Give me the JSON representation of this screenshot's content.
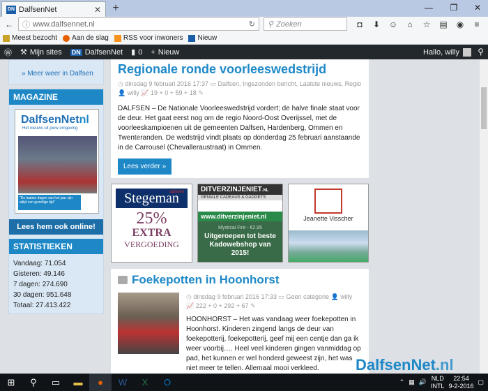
{
  "browser": {
    "tab_title": "DalfsenNet",
    "tab_favicon": "DN",
    "url": "www.dalfsennet.nl",
    "search_placeholder": "Zoeken",
    "bookmarks": [
      {
        "label": "Meest bezocht",
        "icon": "star-icon"
      },
      {
        "label": "Aan de slag",
        "icon": "firefox-icon"
      },
      {
        "label": "RSS voor inwoners",
        "icon": "rss-icon"
      },
      {
        "label": "Nieuw",
        "icon": "dn-icon"
      }
    ]
  },
  "wp_admin": {
    "mijn_sites": "Mijn sites",
    "site_name": "DalfsenNet",
    "comments": "0",
    "new": "Nieuw",
    "greeting": "Hallo, willy"
  },
  "sidebar": {
    "meer_weer": "Meer weer in Dalfsen",
    "magazine_header": "MAGAZINE",
    "magazine_title": "DalfsenNet",
    "magazine_title_suffix": "nl",
    "magazine_sub": "Het nieuws uit jouw omgeving",
    "magazine_caption": "\"De laatste dagen van het jaar zijn altijd een gezellige tijd\"",
    "lees_ook": "Lees hem ook online!",
    "stats_header": "STATISTIEKEN",
    "stats": [
      "Vandaag: 71.054",
      "Gisteren: 49.146",
      "7 dagen: 274.690",
      "30 dagen: 951.648",
      "Totaal: 27.413.422"
    ]
  },
  "article1": {
    "title": "Regionale ronde voorleeswedstrijd",
    "date": "dinsdag 9 februari 2016 17:37",
    "categories": "Dalfsen, Ingezonden bericht, Laatste nieuws, Regio",
    "author": "willy",
    "stats": "19 + 0 + 59 + 18",
    "text": "DALFSEN – De Nationale Voorleeswedstrijd vordert; de halve finale staat voor de deur. Het gaat eerst nog om de regio Noord-Oost Overijssel, met de voorleeskampioenen uit de gemeenten Dalfsen, Hardenberg, Ommen en Twenteranden. De wedstrijd vindt plaats op donderdag 25 februari aanstaande in de Carrousel (Chevalleraustraat) in Ommen.",
    "button": "Lees verder »"
  },
  "ads": {
    "stegeman_small": "opticien",
    "stegeman": "Stegeman",
    "stegeman_pct": "25%",
    "stegeman_extra": "EXTRA",
    "stegeman_verg": "VERGOEDING",
    "ditv_title": "DITVERZINJENIET",
    "ditv_suffix": ".NL",
    "ditv_sub": "GENIALE CADEAUS & GADGETS",
    "ditv_url": "www.ditverzinjeniet.nl",
    "ditv_price": "Mystical Fire - €2,95",
    "ditv_body": "Uitgeroepen tot beste Kadowebshop van 2015!",
    "jv_name": "Jeanette Visscher"
  },
  "article2": {
    "title": "Foekepotten in Hoonhorst",
    "date": "dinsdag 9 februari 2016 17:33",
    "category": "Geen categorie",
    "author": "willy",
    "stats": "222 + 0 + 292 + 67",
    "text": "HOONHORST – Het was vandaag weer foekepotten in Hoonhorst. Kinderen zingend langs de deur van foekepotterij, foekepotterij, geef mij een centje dan ga ik weer voorbij…. Heel veel kinderen gingen vanmiddag op pad, het kunnen er wel honderd geweest zijn, het was niet meer te tellen. Allemaal mooi verkleed."
  },
  "watermark": {
    "text": "DalfsenNet",
    "suffix": ".nl"
  },
  "taskbar": {
    "lang": "NLD",
    "layout": "INTL",
    "time": "22:54",
    "date": "9-2-2016"
  },
  "colors": {
    "accent": "#1e88c7",
    "wp_bar": "#23282d",
    "taskbar": "#101418"
  }
}
